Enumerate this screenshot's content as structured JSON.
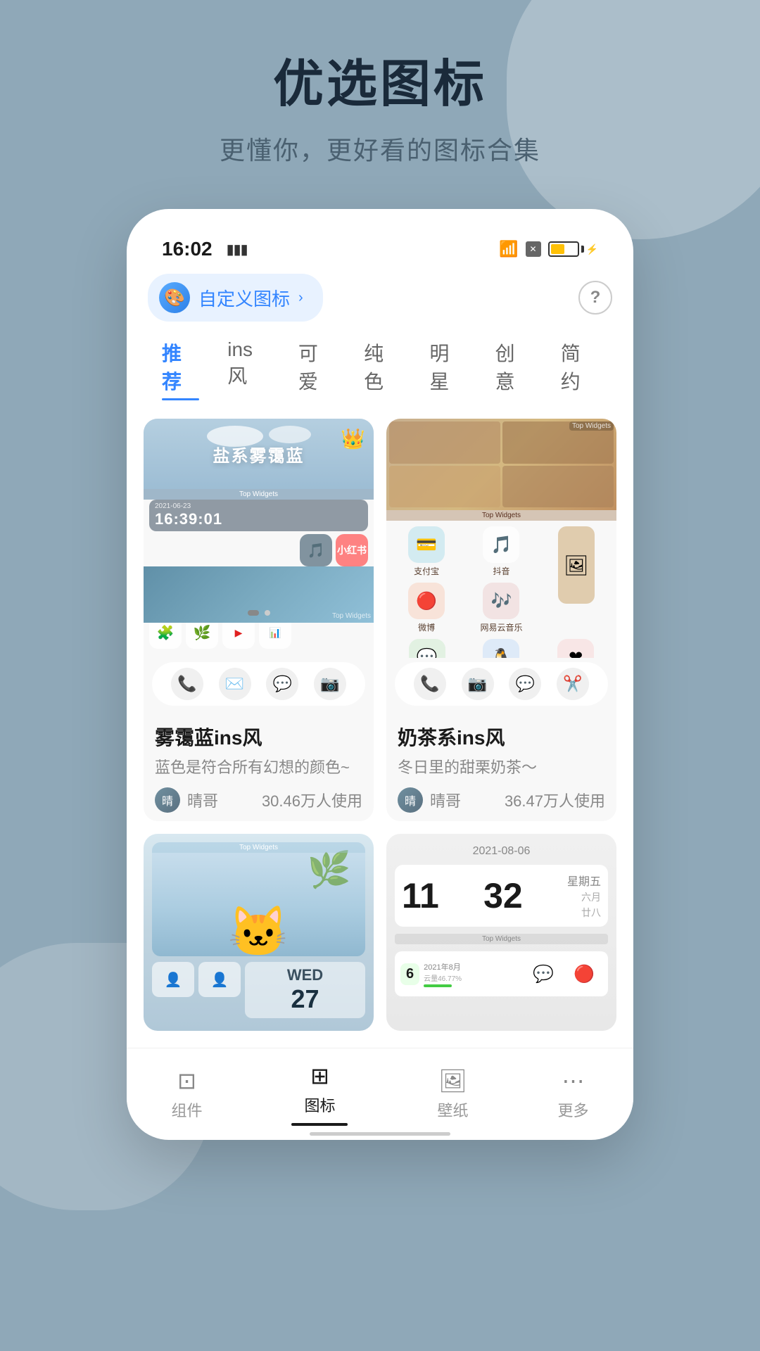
{
  "page": {
    "hero": {
      "title": "优选图标",
      "subtitle": "更懂你，更好看的图标合集"
    },
    "status_bar": {
      "time": "16:02",
      "signal": "|||",
      "wifi": "WiFi",
      "battery": "55%"
    },
    "custom_icon_btn": {
      "label": "自定义图标",
      "chevron": "›"
    },
    "tabs": [
      {
        "label": "推荐",
        "active": true
      },
      {
        "label": "ins风",
        "active": false
      },
      {
        "label": "可爱",
        "active": false
      },
      {
        "label": "纯色",
        "active": false
      },
      {
        "label": "明星",
        "active": false
      },
      {
        "label": "创意",
        "active": false
      },
      {
        "label": "简约",
        "active": false
      }
    ],
    "cards": [
      {
        "id": "misty-blue",
        "title": "雾霭蓝ins风",
        "desc": "蓝色是符合所有幻想的颜色~",
        "author": "晴哥",
        "users": "30.46万人使用",
        "theme_name": "盐系雾霭蓝",
        "has_crown": true
      },
      {
        "id": "milk-tea",
        "title": "奶茶系ins风",
        "desc": "冬日里的甜栗奶茶～",
        "author": "晴哥",
        "users": "36.47万人使用",
        "has_crown": false
      }
    ],
    "bottom_nav": [
      {
        "label": "组件",
        "icon": "⊡",
        "active": false
      },
      {
        "label": "图标",
        "icon": "⊞",
        "active": true
      },
      {
        "label": "壁纸",
        "icon": "⊟",
        "active": false
      },
      {
        "label": "更多",
        "icon": "···",
        "active": false
      }
    ],
    "colors": {
      "accent": "#3385ff",
      "background": "#8fa8b8",
      "card_bg": "#f8f8f8",
      "active_tab": "#3385ff"
    }
  }
}
